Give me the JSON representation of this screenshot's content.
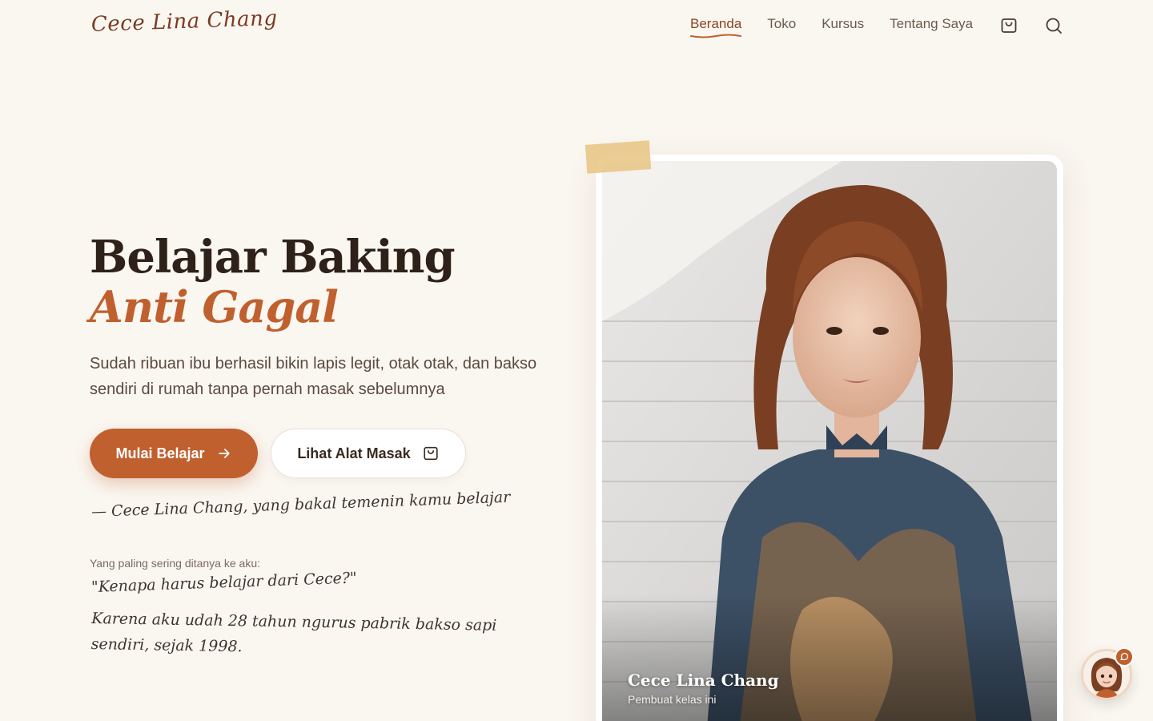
{
  "header": {
    "logo": "Cece Lina Chang",
    "nav": [
      {
        "label": "Beranda",
        "active": true
      },
      {
        "label": "Toko",
        "active": false
      },
      {
        "label": "Kursus",
        "active": false
      },
      {
        "label": "Tentang Saya",
        "active": false
      }
    ],
    "icons": [
      "shopping-bag-icon",
      "search-icon"
    ]
  },
  "hero": {
    "title": "Belajar Baking",
    "accent": "Anti Gagal",
    "description": "Sudah ribuan ibu berhasil bikin lapis legit, otak otak, dan bakso sendiri di rumah tanpa pernah masak sebelumnya",
    "primary_button": "Mulai Belajar",
    "secondary_button": "Lihat Alat Masak",
    "signature": "— Cece Lina Chang, yang bakal temenin kamu belajar",
    "faq_label": "Yang paling sering ditanya ke aku:",
    "faq_question": "\"Kenapa harus belajar dari Cece?\"",
    "faq_answer": "Karena aku udah 28 tahun ngurus pabrik bakso sapi sendiri, sejak 1998."
  },
  "photo": {
    "name": "Cece Lina Chang",
    "role": "Pembuat kelas ini"
  },
  "colors": {
    "background": "#faf6f0",
    "accent": "#c0602f",
    "brand_dark": "#7a3a22"
  }
}
